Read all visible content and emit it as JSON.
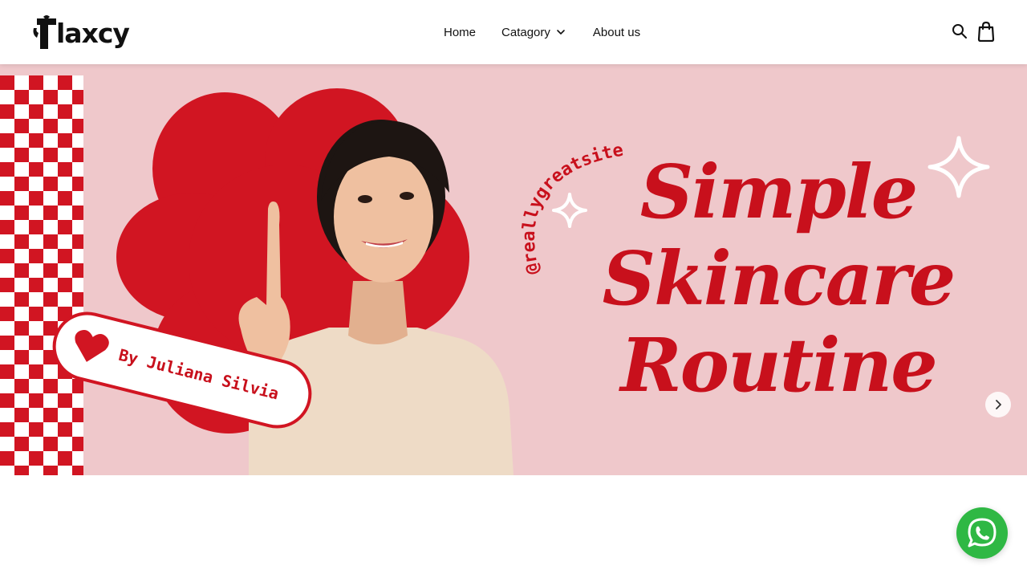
{
  "header": {
    "logo_text": "laxcy",
    "nav": {
      "home": "Home",
      "category": "Catagory",
      "about": "About us"
    },
    "icons": [
      "search-icon",
      "shopping-bag-icon",
      "chevron-down-icon"
    ]
  },
  "hero": {
    "handle": "@reallygreatsite",
    "title_lines": [
      "Simple",
      "Skincare",
      "Routine"
    ],
    "author_tag": "By Juliana Silvia",
    "next_icon": "chevron-right-icon",
    "colors": {
      "background": "#efc8cb",
      "accent_red": "#d11522",
      "checker_white": "#ffffff"
    }
  },
  "floating": {
    "whatsapp_icon": "whatsapp-icon",
    "whatsapp_color": "#2fb844"
  }
}
